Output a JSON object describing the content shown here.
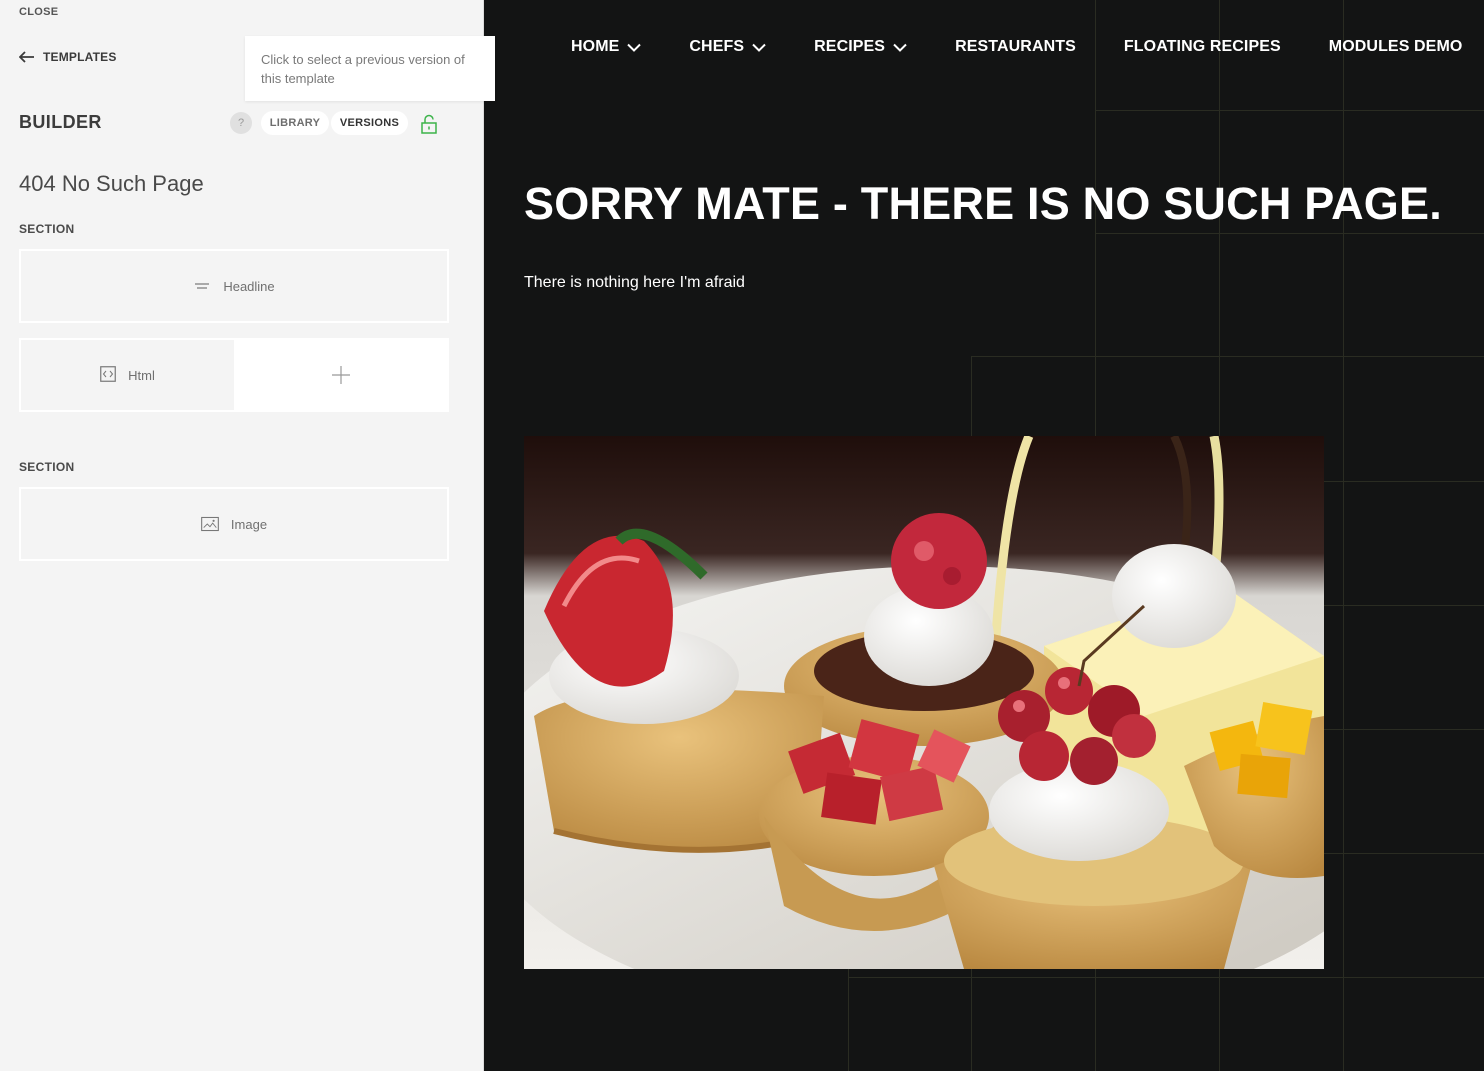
{
  "panel": {
    "close_label": "CLOSE",
    "back_label": "TEMPLATES",
    "tooltip": "Click to select a previous version of this template",
    "builder_title": "BUILDER",
    "help_label": "?",
    "library_label": "LIBRARY",
    "versions_label": "VERSIONS",
    "page_name": "404 No Such Page",
    "sections": [
      {
        "label": "SECTION",
        "modules": [
          "Headline",
          "Html"
        ]
      },
      {
        "label": "SECTION",
        "modules": [
          "Image"
        ]
      }
    ],
    "icons": [
      "arrow-left-icon",
      "lock-open-icon",
      "headline-icon",
      "code-icon",
      "plus-icon",
      "image-icon"
    ],
    "accent_color": "#3cb34a"
  },
  "site": {
    "nav": [
      {
        "label": "HOME",
        "dropdown": true
      },
      {
        "label": "CHEFS",
        "dropdown": true
      },
      {
        "label": "RECIPES",
        "dropdown": true
      },
      {
        "label": "RESTAURANTS",
        "dropdown": false
      },
      {
        "label": "FLOATING RECIPES",
        "dropdown": false
      },
      {
        "label": "MODULES DEMO",
        "dropdown": false
      }
    ],
    "headline": "SORRY MATE - THERE IS NO SUCH PAGE.",
    "subtext": "There is nothing here I'm afraid",
    "background_color": "#131414"
  }
}
